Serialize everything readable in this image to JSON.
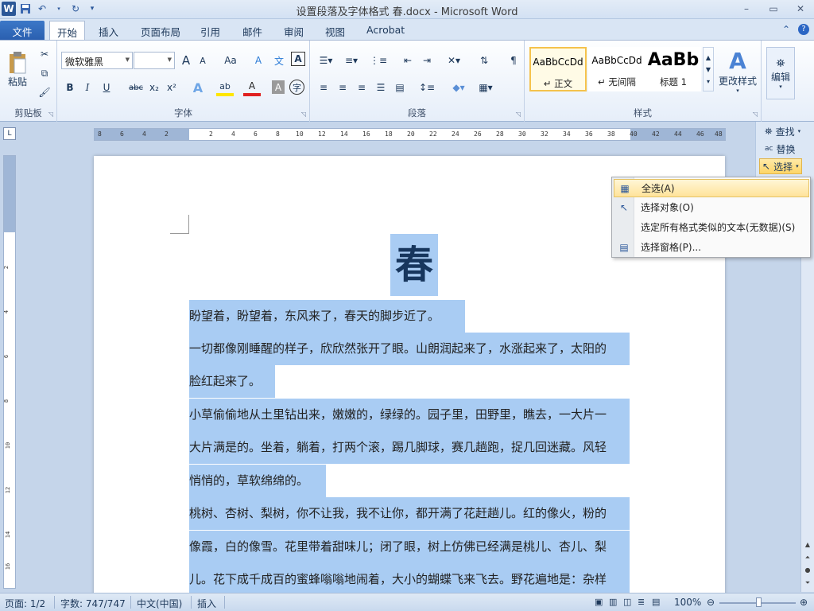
{
  "title_bar": {
    "title": "设置段落及字体格式 春.docx  -  Microsoft Word",
    "min": "–",
    "max": "▭",
    "close": "✕"
  },
  "tabs": [
    "文件",
    "开始",
    "插入",
    "页面布局",
    "引用",
    "邮件",
    "审阅",
    "视图",
    "Acrobat"
  ],
  "ribbon": {
    "clipboard": {
      "label": "剪贴板",
      "paste": "粘贴"
    },
    "font": {
      "label": "字体",
      "font_name": "微软雅黑",
      "font_size": "",
      "bold": "B",
      "italic": "I",
      "underline": "U",
      "strike": "abc",
      "sub": "x₂",
      "sup": "x²",
      "grow": "A",
      "shrink": "A",
      "case": "Aa",
      "clear": "A",
      "phonetic": "文",
      "border_char": "A",
      "color_a": "A",
      "shade_a": "A",
      "circle": "字"
    },
    "paragraph": {
      "label": "段落"
    },
    "styles": {
      "label": "样式",
      "items": [
        {
          "sample": "AaBbCcDd",
          "name": "↵ 正文"
        },
        {
          "sample": "AaBbCcDd",
          "name": "↵ 无间隔"
        },
        {
          "sample": "AaBb",
          "name": "标题 1"
        }
      ],
      "change": "更改样式"
    },
    "editing": {
      "label": "编辑"
    }
  },
  "find_panel": {
    "find": "查找",
    "replace": "替换",
    "select": "选择"
  },
  "select_menu": [
    {
      "icon": "select-all-icon",
      "text": "全选(A)"
    },
    {
      "icon": "select-objects-icon",
      "text": "选择对象(O)"
    },
    {
      "icon": "",
      "text": "选定所有格式类似的文本(无数据)(S)"
    },
    {
      "icon": "selection-pane-icon",
      "text": "选择窗格(P)..."
    }
  ],
  "document": {
    "heading": "春",
    "lines": [
      "盼望着，盼望着，东风来了，春天的脚步近了。",
      "一切都像刚睡醒的样子，欣欣然张开了眼。山朗润起来了，水涨起来了，太阳的",
      "脸红起来了。",
      "小草偷偷地从土里钻出来，嫩嫩的，绿绿的。园子里，田野里，瞧去，一大片一",
      "大片满是的。坐着，躺着，打两个滚，踢几脚球，赛几趟跑，捉几回迷藏。风轻",
      "悄悄的，草软绵绵的。",
      "桃树、杏树、梨树，你不让我，我不让你，都开满了花赶趟儿。红的像火，粉的",
      "像霞，白的像雪。花里带着甜味儿；闭了眼，树上仿佛已经满是桃儿、杏儿、梨",
      "儿。花下成千成百的蜜蜂嗡嗡地闹着，大小的蝴蝶飞来飞去。野花遍地是：杂样"
    ]
  },
  "ruler": {
    "h_ticks": [
      "8",
      "6",
      "4",
      "2",
      "2",
      "4",
      "6",
      "8",
      "10",
      "12",
      "14",
      "16",
      "18",
      "20",
      "22",
      "24",
      "26",
      "28",
      "30",
      "32",
      "34",
      "36",
      "38",
      "40",
      "42",
      "44",
      "46",
      "48"
    ],
    "v_ticks": [
      "2",
      "4",
      "6",
      "8",
      "10",
      "12",
      "14",
      "16",
      "18",
      "20"
    ]
  },
  "status_bar": {
    "page": "页面: 1/2",
    "words": "字数: 747/747",
    "lang": "中文(中国)",
    "mode": "插入",
    "zoom": "100%"
  }
}
